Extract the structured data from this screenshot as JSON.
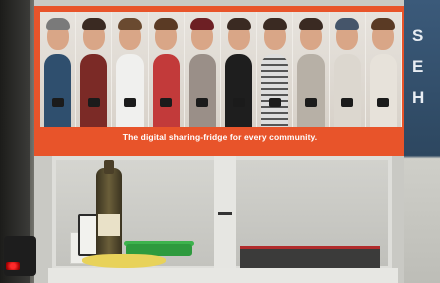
{
  "poster": {
    "tagline": "The digital sharing-fridge for every community.",
    "accent_color": "#e8542a",
    "people_count": 10
  },
  "side_text": {
    "letters": [
      "S",
      "E",
      "H"
    ]
  },
  "scene": {
    "indicator_color": "#ff2a2a"
  }
}
